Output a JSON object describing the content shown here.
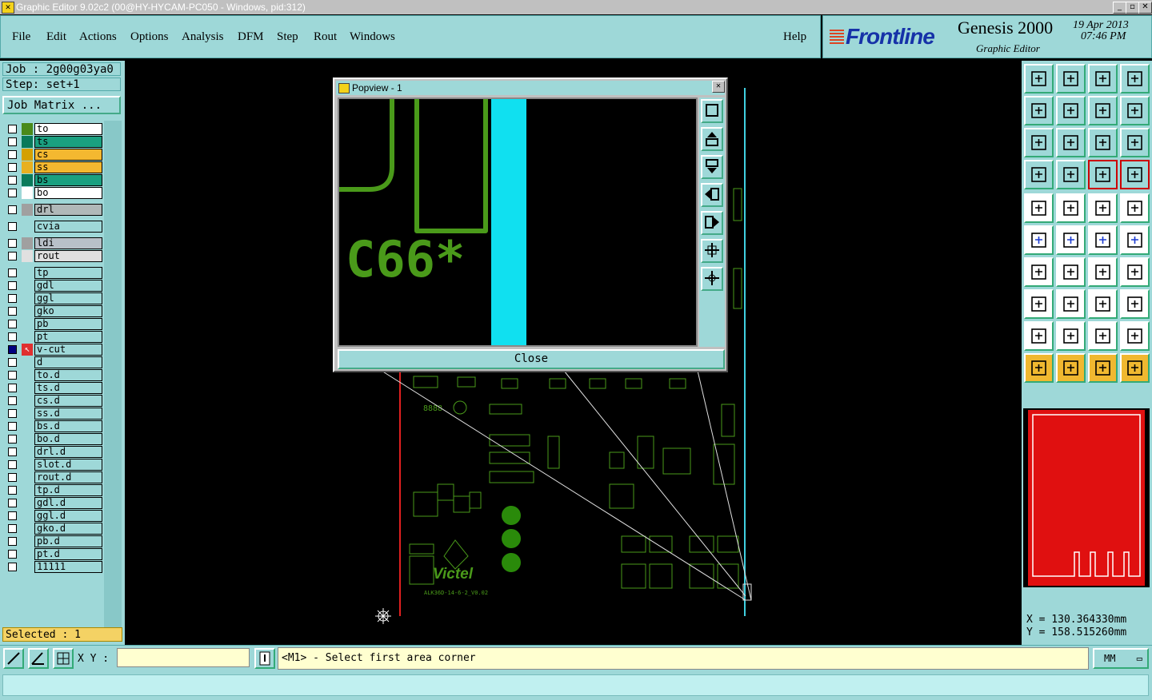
{
  "window": {
    "title": "Graphic Editor 9.02c2 (00@HY-HYCAM-PC050 - Windows, pid:312)"
  },
  "menu": [
    "File",
    "Edit",
    "Actions",
    "Options",
    "Analysis",
    "DFM",
    "Step",
    "Rout",
    "Windows"
  ],
  "help_label": "Help",
  "brand": {
    "logo": "Frontline",
    "product": "Genesis 2000",
    "subtitle": "Graphic Editor",
    "date": "19 Apr 2013",
    "time": "07:46 PM"
  },
  "job": {
    "job_label": "Job : 2g00g03ya0",
    "step_label": "Step: set+1",
    "matrix_button": "Job Matrix ..."
  },
  "layers": [
    {
      "name": "to",
      "color": "#4a8a1a",
      "bg": "#ffffff"
    },
    {
      "name": "ts",
      "color": "#0a7a5a",
      "bg": "#1aa080"
    },
    {
      "name": "cs",
      "color": "#d4a000",
      "bg": "#f4b830"
    },
    {
      "name": "ss",
      "color": "#e8b020",
      "bg": "#f4b830"
    },
    {
      "name": "bs",
      "color": "#0a7a5a",
      "bg": "#1aa080"
    },
    {
      "name": "bo",
      "color": "#ffffff",
      "bg": "#ffffff"
    },
    {
      "name": "drl",
      "color": "#a0a0a0",
      "bg": "#b0b8b8"
    },
    {
      "name": "cvia",
      "color": "#9ed8d8",
      "bg": "#9ed8d8"
    },
    {
      "name": "ldi",
      "color": "#a0a0a0",
      "bg": "#b8c0c8"
    },
    {
      "name": "rout",
      "color": "#e0e0e0",
      "bg": "#e0e0e0"
    },
    {
      "name": "tp",
      "color": "#9ed8d8",
      "bg": "#9ed8d8"
    },
    {
      "name": "gdl",
      "color": "#9ed8d8",
      "bg": "#9ed8d8"
    },
    {
      "name": "ggl",
      "color": "#9ed8d8",
      "bg": "#9ed8d8"
    },
    {
      "name": "gko",
      "color": "#9ed8d8",
      "bg": "#9ed8d8"
    },
    {
      "name": "pb",
      "color": "#9ed8d8",
      "bg": "#9ed8d8"
    },
    {
      "name": "pt",
      "color": "#9ed8d8",
      "bg": "#9ed8d8"
    },
    {
      "name": "v-cut",
      "color": "#e03030",
      "bg": "#9ed8d8"
    },
    {
      "name": "d",
      "color": "#9ed8d8",
      "bg": "#9ed8d8"
    },
    {
      "name": "to.d",
      "color": "#9ed8d8",
      "bg": "#9ed8d8"
    },
    {
      "name": "ts.d",
      "color": "#9ed8d8",
      "bg": "#9ed8d8"
    },
    {
      "name": "cs.d",
      "color": "#9ed8d8",
      "bg": "#9ed8d8"
    },
    {
      "name": "ss.d",
      "color": "#9ed8d8",
      "bg": "#9ed8d8"
    },
    {
      "name": "bs.d",
      "color": "#9ed8d8",
      "bg": "#9ed8d8"
    },
    {
      "name": "bo.d",
      "color": "#9ed8d8",
      "bg": "#9ed8d8"
    },
    {
      "name": "drl.d",
      "color": "#9ed8d8",
      "bg": "#9ed8d8"
    },
    {
      "name": "slot.d",
      "color": "#9ed8d8",
      "bg": "#9ed8d8"
    },
    {
      "name": "rout.d",
      "color": "#9ed8d8",
      "bg": "#9ed8d8"
    },
    {
      "name": "tp.d",
      "color": "#9ed8d8",
      "bg": "#9ed8d8"
    },
    {
      "name": "gdl.d",
      "color": "#9ed8d8",
      "bg": "#9ed8d8"
    },
    {
      "name": "ggl.d",
      "color": "#9ed8d8",
      "bg": "#9ed8d8"
    },
    {
      "name": "gko.d",
      "color": "#9ed8d8",
      "bg": "#9ed8d8"
    },
    {
      "name": "pb.d",
      "color": "#9ed8d8",
      "bg": "#9ed8d8"
    },
    {
      "name": "pt.d",
      "color": "#9ed8d8",
      "bg": "#9ed8d8"
    },
    {
      "name": "11111",
      "color": "#9ed8d8",
      "bg": "#9ed8d8"
    }
  ],
  "selected_label": "Selected : 1",
  "popview": {
    "title": "Popview - 1",
    "close_label": "Close",
    "part_label": "C66*"
  },
  "board": {
    "brand_text": "Victel",
    "model_text": "ALK36D-14-6-2_V0.02",
    "small_text": "8888"
  },
  "coords": {
    "x": "X  =  130.364330mm",
    "y": "Y  =  158.515260mm"
  },
  "bottom": {
    "xy_label": "X Y :",
    "xy_value": "",
    "prompt": "<M1> - Select first area corner",
    "units": "MM"
  },
  "colors": {
    "panel": "#9ed8d8",
    "board_green": "#4a9a1a",
    "cyan_trace": "#00e0f0",
    "overview_red": "#e01010"
  }
}
